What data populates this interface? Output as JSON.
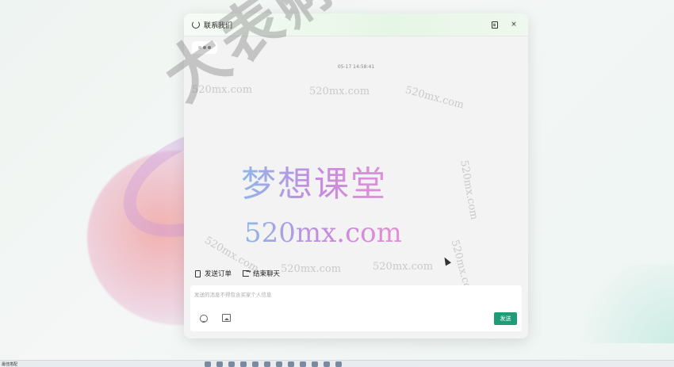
{
  "window": {
    "title": "联系我们",
    "close_glyph": "×",
    "icons": {
      "title": "headset-icon",
      "clip": "clipboard-icon",
      "close": "close-icon"
    }
  },
  "messages": {
    "timestamp": "05-17 14:58:41"
  },
  "watermarks": {
    "small": "520mx.com",
    "brand_cn": "梦想课堂",
    "brand_url": "520mx.com",
    "stamp": "大表孵化中心"
  },
  "toolbar": {
    "send_order": "发送订单",
    "end_chat": "结束聊天"
  },
  "input": {
    "placeholder": "发送的消息不得包含买家个人信息",
    "value": ""
  },
  "actions": {
    "send_label": "发送"
  },
  "taskbar": {
    "label": "最佳搭配"
  },
  "colors": {
    "accent": "#1e9c78"
  }
}
